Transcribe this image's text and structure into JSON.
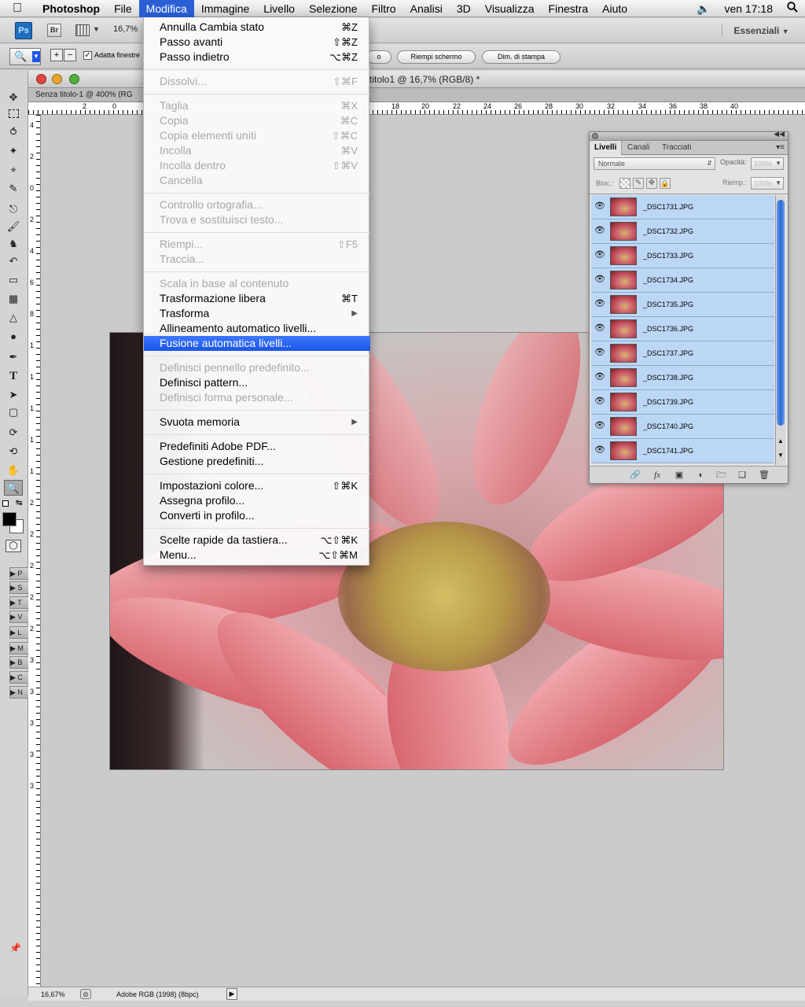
{
  "menubar": {
    "app_name": "Photoshop",
    "items": [
      "File",
      "Modifica",
      "Immagine",
      "Livello",
      "Selezione",
      "Filtro",
      "Analisi",
      "3D",
      "Visualizza",
      "Finestra",
      "Aiuto"
    ],
    "active_item": "Modifica",
    "clock": "ven 17:18"
  },
  "appbar": {
    "ps_logo": "Ps",
    "br_logo": "Br",
    "zoom": "16,7%",
    "workspace": "Essenziali"
  },
  "options": {
    "fit_window": "Adatta finestre",
    "partial_button": "o",
    "fill_screen": "Riempi schermo",
    "print_size": "Dim. di stampa"
  },
  "document": {
    "title": "titolo1 @ 16,7% (RGB/8) *",
    "tab_label": "Senza titolo-1 @ 400% (RG"
  },
  "rulers": {
    "top": [
      "2",
      "0",
      "18",
      "20",
      "22",
      "24",
      "26",
      "28",
      "30",
      "32",
      "34",
      "36",
      "38",
      "40"
    ],
    "left": [
      "4",
      "2",
      "0",
      "2",
      "4",
      "6",
      "8",
      "1",
      "1",
      "1",
      "1",
      "1",
      "2",
      "2",
      "2",
      "2",
      "2",
      "3",
      "3",
      "3",
      "3",
      "3"
    ]
  },
  "edit_menu": [
    {
      "label": "Annulla Cambia stato",
      "shortcut": "⌘Z",
      "enabled": true
    },
    {
      "label": "Passo avanti",
      "shortcut": "⇧⌘Z",
      "enabled": true
    },
    {
      "label": "Passo indietro",
      "shortcut": "⌥⌘Z",
      "enabled": true
    },
    {
      "label": "Dissolvi...",
      "shortcut": "⇧⌘F",
      "enabled": false
    },
    {
      "label": "Taglia",
      "shortcut": "⌘X",
      "enabled": false
    },
    {
      "label": "Copia",
      "shortcut": "⌘C",
      "enabled": false
    },
    {
      "label": "Copia elementi uniti",
      "shortcut": "⇧⌘C",
      "enabled": false
    },
    {
      "label": "Incolla",
      "shortcut": "⌘V",
      "enabled": false
    },
    {
      "label": "Incolla dentro",
      "shortcut": "⇧⌘V",
      "enabled": false
    },
    {
      "label": "Cancella",
      "shortcut": "",
      "enabled": false
    },
    {
      "label": "Controllo ortografia...",
      "shortcut": "",
      "enabled": false
    },
    {
      "label": "Trova e sostituisci testo...",
      "shortcut": "",
      "enabled": false
    },
    {
      "label": "Riempi...",
      "shortcut": "⇧F5",
      "enabled": false
    },
    {
      "label": "Traccia...",
      "shortcut": "",
      "enabled": false
    },
    {
      "label": "Scala in base al contenuto",
      "shortcut": "",
      "enabled": false
    },
    {
      "label": "Trasformazione libera",
      "shortcut": "⌘T",
      "enabled": true
    },
    {
      "label": "Trasforma",
      "shortcut": "",
      "enabled": true,
      "submenu": true
    },
    {
      "label": "Allineamento automatico livelli...",
      "shortcut": "",
      "enabled": true
    },
    {
      "label": "Fusione automatica livelli...",
      "shortcut": "",
      "enabled": true,
      "highlighted": true
    },
    {
      "label": "Definisci pennello predefinito...",
      "shortcut": "",
      "enabled": false
    },
    {
      "label": "Definisci pattern...",
      "shortcut": "",
      "enabled": true
    },
    {
      "label": "Definisci forma personale...",
      "shortcut": "",
      "enabled": false
    },
    {
      "label": "Svuota memoria",
      "shortcut": "",
      "enabled": true,
      "submenu": true
    },
    {
      "label": "Predefiniti Adobe PDF...",
      "shortcut": "",
      "enabled": true
    },
    {
      "label": "Gestione predefiniti...",
      "shortcut": "",
      "enabled": true
    },
    {
      "label": "Impostazioni colore...",
      "shortcut": "⇧⌘K",
      "enabled": true
    },
    {
      "label": "Assegna profilo...",
      "shortcut": "",
      "enabled": true
    },
    {
      "label": "Converti in profilo...",
      "shortcut": "",
      "enabled": true
    },
    {
      "label": "Scelte rapide da tastiera...",
      "shortcut": "⌥⇧⌘K",
      "enabled": true
    },
    {
      "label": "Menu...",
      "shortcut": "⌥⇧⌘M",
      "enabled": true
    }
  ],
  "layers_panel": {
    "tabs": [
      "Livelli",
      "Canali",
      "Tracciati"
    ],
    "active_tab": "Livelli",
    "blend_mode": "Normale",
    "opacity_label": "Opacità:",
    "opacity_value": "100%",
    "lock_label": "Bloc.:",
    "fill_label": "Riemp.:",
    "fill_value": "100%",
    "layers": [
      "_DSC1731.JPG",
      "_DSC1732.JPG",
      "_DSC1733.JPG",
      "_DSC1734.JPG",
      "_DSC1735.JPG",
      "_DSC1736.JPG",
      "_DSC1737.JPG",
      "_DSC1738.JPG",
      "_DSC1739.JPG",
      "_DSC1740.JPG",
      "_DSC1741.JPG"
    ],
    "footer_fx": "fx"
  },
  "statusbar": {
    "zoom": "16,67%",
    "profile": "Adobe RGB (1998) (8bpc)"
  },
  "collapsed_panels": [
    "P",
    "S",
    "T",
    "V",
    "L",
    "M",
    "B",
    "C",
    "N"
  ],
  "colors": {
    "menu_highlight": "#1a55e8",
    "layer_selected": "#bcd7f5",
    "ps_blue": "#1f6fbf"
  }
}
